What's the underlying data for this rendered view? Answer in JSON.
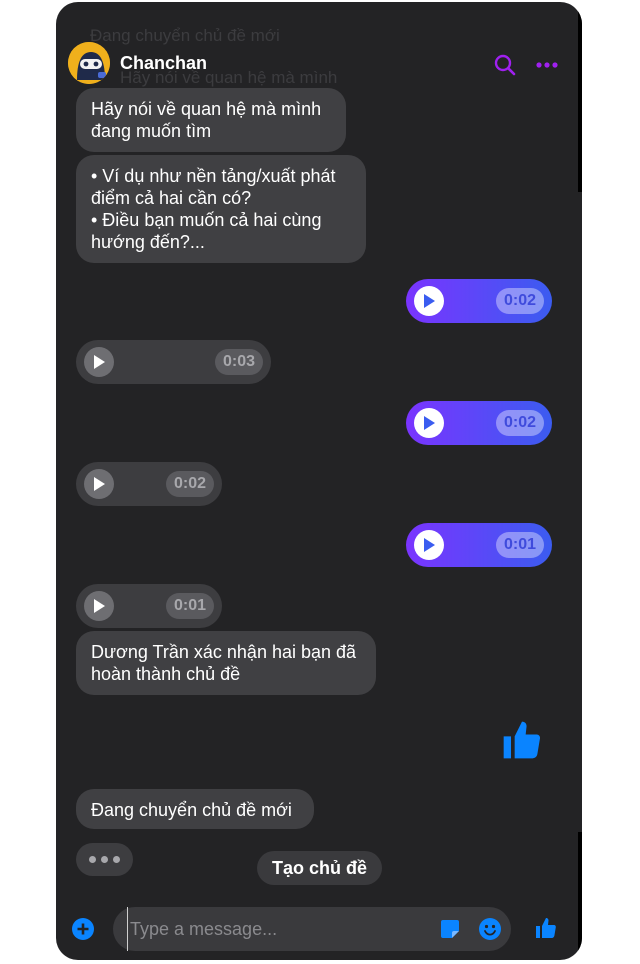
{
  "header": {
    "contact_name": "Chanchan",
    "ghost_lines": [
      "Đang chuyển chủ đề mới",
      "Hãy nói về quan hệ mà mình"
    ]
  },
  "messages": {
    "incoming_1": "Hãy nói về quan hệ mà mình\nđang muốn tìm",
    "incoming_2": "• Ví dụ như nền tảng/xuất phát\nđiểm cả hai cần có?\n• Điều bạn muốn cả hai cùng\nhướng đến?...",
    "voice_out_1": "0:02",
    "voice_in_1": "0:03",
    "voice_out_2": "0:02",
    "voice_in_2": "0:02",
    "voice_out_3": "0:01",
    "voice_in_3": "0:01",
    "incoming_3": "Dương Trần xác nhận hai bạn đã\nhoàn thành chủ đề",
    "incoming_4": "Đang chuyển chủ đề mới"
  },
  "quick_reply": {
    "label": "Tạo chủ đề"
  },
  "composer": {
    "placeholder": "Type a message..."
  },
  "colors": {
    "accent": "#a020f0",
    "messenger_blue": "#0a84ff",
    "panel_bg": "#232325",
    "bubble_in": "#404043",
    "outgoing_gradient_start": "#7a34ff",
    "outgoing_gradient_end": "#3b5cf0"
  },
  "icons": [
    "avatar-ninja-icon",
    "search-icon",
    "more-icon",
    "play-icon",
    "thumbs-up-icon",
    "plus-icon",
    "sticker-icon",
    "emoji-icon"
  ]
}
